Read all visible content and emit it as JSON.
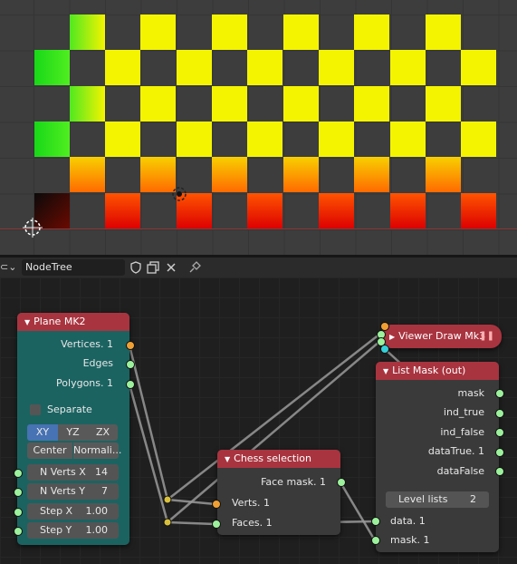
{
  "header": {
    "tree_name": "NodeTree"
  },
  "nodes": {
    "plane": {
      "title": "Plane MK2",
      "outputs": [
        "Vertices. 1",
        "Edges",
        "Polygons. 1"
      ],
      "separate_label": "Separate",
      "plane_buttons": [
        "XY",
        "YZ",
        "ZX"
      ],
      "center_label": "Center",
      "normalize_label": "Normali...",
      "fields": [
        {
          "label": "N Verts X",
          "value": "14"
        },
        {
          "label": "N Verts Y",
          "value": "7"
        },
        {
          "label": "Step X",
          "value": "1.00"
        },
        {
          "label": "Step Y",
          "value": "1.00"
        }
      ]
    },
    "chess": {
      "title": "Chess selection",
      "output": "Face mask. 1",
      "inputs": [
        "Verts. 1",
        "Faces. 1"
      ]
    },
    "viewer": {
      "title": "Viewer Draw Mk3"
    },
    "listmask": {
      "title": "List Mask (out)",
      "outputs": [
        "mask",
        "ind_true",
        "ind_false",
        "dataTrue. 1",
        "dataFalse"
      ],
      "level_label": "Level lists",
      "level_value": "2",
      "inputs": [
        "data. 1",
        "mask. 1"
      ]
    }
  },
  "colors": {
    "plane_header": "#a8343f",
    "plane_body": "#1b6361",
    "chess_header": "#a8343f",
    "viewer_header": "#a8343f",
    "node_body": "#3a3a3a",
    "socket_vertices": "#f0a033",
    "socket_generic": "#9cf29c",
    "socket_cyan": "#35d0d8"
  }
}
